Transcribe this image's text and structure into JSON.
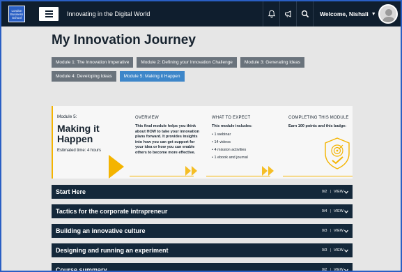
{
  "header": {
    "logo_lines": [
      "London",
      "Business",
      "School"
    ],
    "title": "Innovating in the Digital World",
    "icons": [
      "bell-icon",
      "megaphone-icon",
      "search-icon"
    ],
    "welcome": "Welcome, Nishali"
  },
  "page": {
    "title": "My Innovation Journey"
  },
  "modules": [
    {
      "label": "Module 1: The Innovation Imperative",
      "active": false
    },
    {
      "label": "Module 2: Defining your Innovation Challenge",
      "active": false
    },
    {
      "label": "Module 3: Generating Ideas",
      "active": false
    },
    {
      "label": "Module 4: Developing Ideas",
      "active": false
    },
    {
      "label": "Module 5: Making it Happen",
      "active": true
    }
  ],
  "module_panel": {
    "number": "Module 5:",
    "title_line1": "Making it",
    "title_line2": "Happen",
    "time": "Estimated time: 4 hours",
    "overview_heading": "OVERVIEW",
    "overview_text": "This final module helps you think about HOW to take your innovation plans forward. It provides insights into how you can get support for your idea or how you can enable others to become more effective.",
    "expect_heading": "WHAT TO EXPECT",
    "expect_intro": "This module includes:",
    "expect_items": [
      "• 1 webinar",
      "• 14 videos",
      "• 4 mission activities",
      "• 1 ebook and journal"
    ],
    "completing_heading": "COMPLETING THIS MODULE",
    "completing_text": "Earn 100 points and this badge:",
    "accent_color": "#f4b400"
  },
  "sections": [
    {
      "label": "Start Here",
      "progress": "0/2",
      "view": "VIEW"
    },
    {
      "label": "Tactics for the corporate intrapreneur",
      "progress": "0/4",
      "view": "VIEW"
    },
    {
      "label": "Building an innovative culture",
      "progress": "0/3",
      "view": "VIEW"
    },
    {
      "label": "Designing and running an experiment",
      "progress": "0/3",
      "view": "VIEW"
    },
    {
      "label": "Course summary",
      "progress": "0/2",
      "view": "VIEW"
    }
  ]
}
